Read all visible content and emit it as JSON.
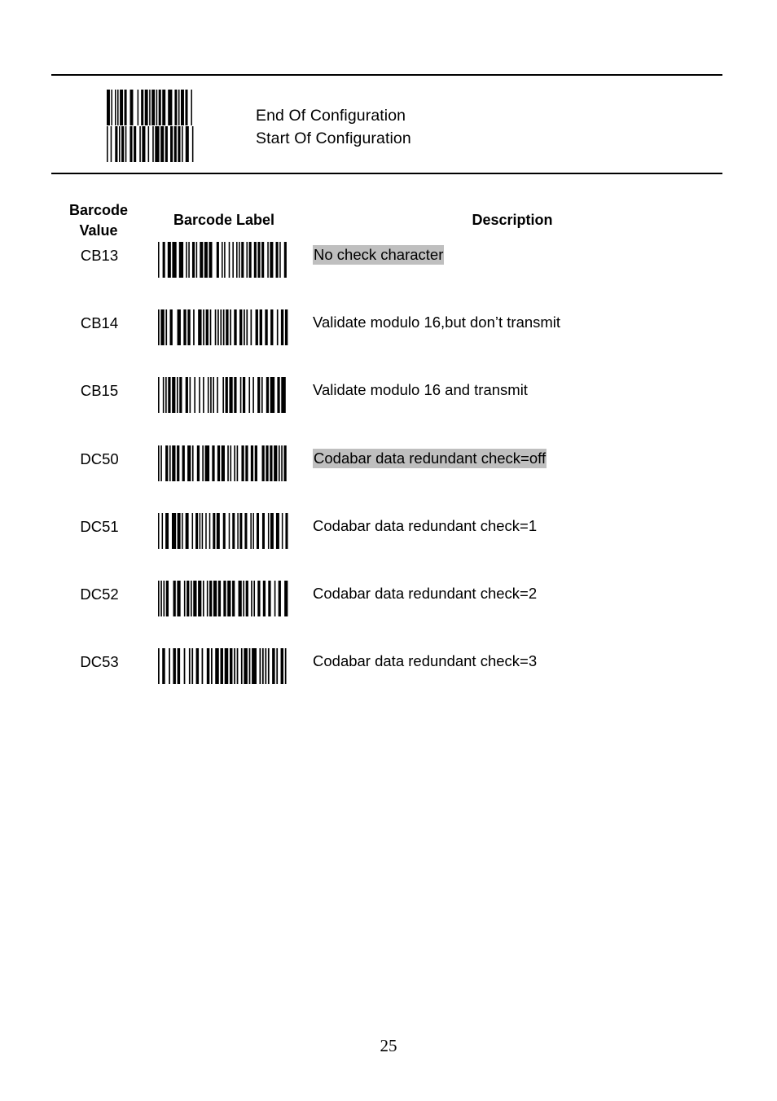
{
  "document": {
    "page_number": "25"
  },
  "config_header": {
    "barcode_name": "configuration-barcode",
    "lines": [
      "End Of Configuration",
      "Start Of Configuration"
    ]
  },
  "table": {
    "headers": {
      "value": "Barcode\nValue",
      "value_line1": "Barcode",
      "value_line2": "Value",
      "label": "Barcode Label",
      "description": "Description"
    },
    "highlight_color": "#bfbfbf",
    "rows": [
      {
        "value": "CB13",
        "description": "No check character",
        "highlighted": true,
        "barcode_seed": 13
      },
      {
        "value": "CB14",
        "description": "Validate modulo 16,but don’t transmit",
        "highlighted": false,
        "barcode_seed": 14
      },
      {
        "value": "CB15",
        "description": "Validate modulo 16 and transmit",
        "highlighted": false,
        "barcode_seed": 15
      },
      {
        "value": "DC50",
        "description": "Codabar data redundant check=off",
        "highlighted": true,
        "barcode_seed": 50
      },
      {
        "value": "DC51",
        "description": "Codabar data redundant check=1",
        "highlighted": false,
        "barcode_seed": 51
      },
      {
        "value": "DC52",
        "description": "Codabar data redundant check=2",
        "highlighted": false,
        "barcode_seed": 52
      },
      {
        "value": "DC53",
        "description": "Codabar data redundant check=3",
        "highlighted": false,
        "barcode_seed": 53
      }
    ]
  }
}
